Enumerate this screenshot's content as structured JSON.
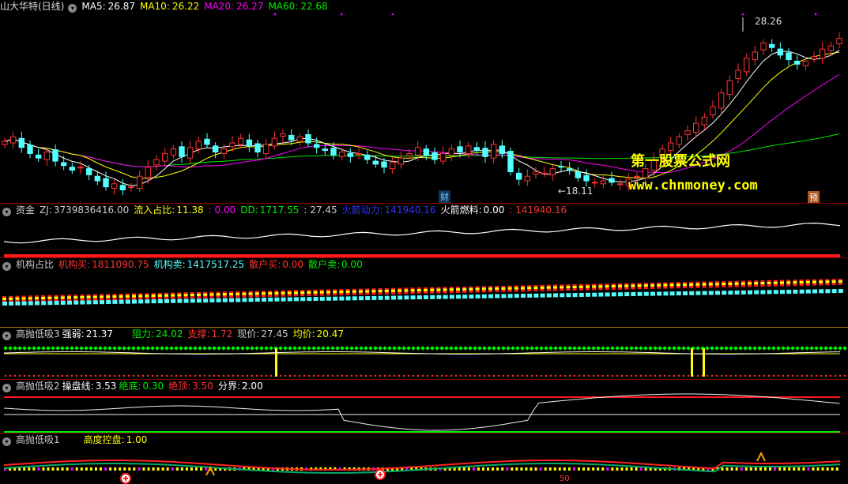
{
  "main": {
    "title": "山大华特(日线)",
    "ma5_label": "MA5:",
    "ma5": "26.87",
    "ma10_label": "MA10:",
    "ma10": "26.22",
    "ma20_label": "MA20:",
    "ma20": "26.27",
    "ma60_label": "MA60:",
    "ma60": "22.68",
    "high_label": "28.26",
    "low_label": "←18.11",
    "tag_cai": "财",
    "tag_yu": "预",
    "watermark_cn": "第一股票公式网",
    "watermark_url": "www.chnmoney.com"
  },
  "zijin": {
    "name": "资金",
    "zj_label": "ZJ:",
    "zj": "3739836416.00",
    "lrzb_label": "流入占比:",
    "lrzb": "11.38",
    "v2": ": 0.00",
    "dd_label": "DD:",
    "dd": "1717.55",
    "v3": ": 27.45",
    "hjdl_label": "火箭动力:",
    "hjdl": "141940.16",
    "hjrl_label": "火箭燃料:",
    "hjrl": "0.00",
    "v4": ": 141940.16"
  },
  "jigou": {
    "name": "机构占比",
    "jgm_label": "机构买:",
    "jgm": "1811090.75",
    "jgs_label": "机构卖:",
    "jgs": "1417517.25",
    "shm_label": "散户买:",
    "shm": "0.00",
    "shs_label": "散户卖:",
    "shs": "0.00"
  },
  "gp3": {
    "name": "高抛低吸3",
    "qr_label": "强弱:",
    "qr": "21.37",
    "zl_label": "阻力:",
    "zl": "24.02",
    "zc_label": "支撑:",
    "zc": "1.72",
    "xj_label": "现价:",
    "xj": "27.45",
    "jj_label": "均价:",
    "jj": "20.47"
  },
  "gp2": {
    "name": "高抛低吸2",
    "cpx_label": "操盘线:",
    "cpx": "3.53",
    "jd_label": "绝底:",
    "jd": "0.30",
    "jdg_label": "绝顶:",
    "jdg": "3.50",
    "fj_label": "分界:",
    "fj": "2.00"
  },
  "gp1": {
    "name": "高抛低吸1",
    "gdkp_label": "高度控盘:",
    "gdkp": "1.00",
    "bottom_mark": "50"
  },
  "colors": {
    "up": "#ff3232",
    "down": "#54ffff",
    "ma5": "#ffffff",
    "ma10": "#ffff00",
    "ma20": "#ff00ff",
    "ma60": "#00e600"
  },
  "chart_data": {
    "type": "candlestick",
    "closes": [
      20.6,
      20.9,
      20.2,
      19.8,
      19.5,
      19.9,
      19.3,
      19.0,
      18.7,
      18.9,
      18.4,
      18.0,
      17.6,
      17.8,
      17.4,
      17.6,
      18.3,
      18.9,
      19.4,
      19.8,
      20.1,
      19.6,
      20.2,
      20.6,
      20.4,
      19.9,
      20.1,
      20.5,
      20.8,
      20.3,
      19.9,
      20.4,
      20.8,
      21.1,
      20.7,
      20.9,
      20.5,
      20.2,
      20.0,
      19.7,
      19.9,
      19.6,
      19.8,
      19.4,
      19.1,
      18.9,
      19.2,
      19.5,
      19.8,
      20.2,
      19.7,
      19.4,
      19.8,
      20.1,
      19.9,
      20.3,
      20.0,
      19.6,
      20.4,
      19.8,
      18.6,
      18.1,
      18.3,
      18.6,
      18.5,
      18.8,
      18.9,
      18.7,
      18.2,
      18.0,
      17.9,
      18.0,
      17.9,
      17.8,
      18.1,
      18.3,
      18.8,
      19.4,
      20.1,
      20.5,
      20.9,
      21.3,
      21.8,
      22.2,
      22.9,
      23.8,
      24.6,
      25.3,
      26.1,
      26.5,
      27.1,
      26.8,
      26.3,
      26.0,
      25.7,
      25.9,
      26.2,
      26.7,
      26.9,
      27.4
    ],
    "range_marks": {
      "high": 28.26,
      "low": 18.11
    },
    "ma5": "26.87",
    "ma10": "26.22",
    "ma20": "26.27",
    "ma60": "22.68"
  }
}
